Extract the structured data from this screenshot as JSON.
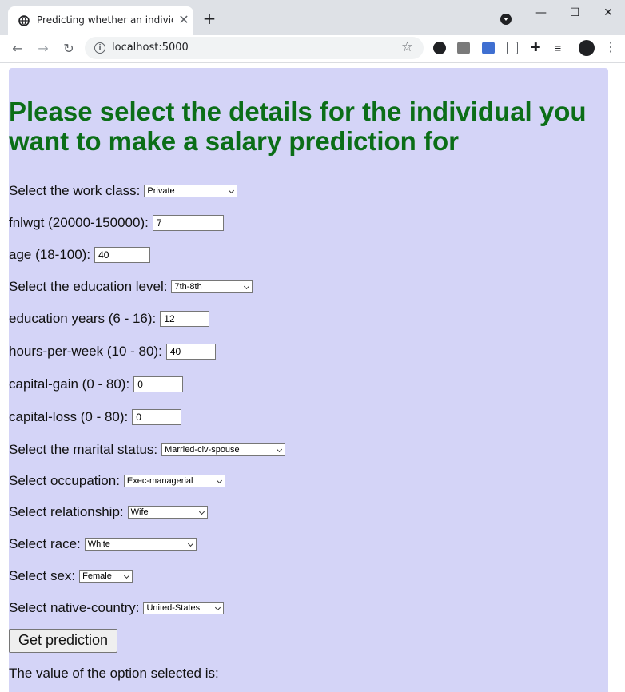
{
  "browser": {
    "tab_title": "Predicting whether an individual",
    "url": "localhost:5000"
  },
  "page": {
    "heading": "Please select the details for the individual you want to make a salary prediction for",
    "fields": {
      "workclass": {
        "label": "Select the work class:",
        "value": "Private"
      },
      "fnlwgt": {
        "label": "fnlwgt (20000-150000):",
        "value": "7"
      },
      "age": {
        "label": "age (18-100):",
        "value": "40"
      },
      "education": {
        "label": "Select the education level:",
        "value": "7th-8th"
      },
      "education_years": {
        "label": "education years (6 - 16):",
        "value": "12"
      },
      "hours_per_week": {
        "label": "hours-per-week (10 - 80):",
        "value": "40"
      },
      "capital_gain": {
        "label": "capital-gain (0 - 80):",
        "value": "0"
      },
      "capital_loss": {
        "label": "capital-loss (0 - 80):",
        "value": "0"
      },
      "marital_status": {
        "label": "Select the marital status:",
        "value": "Married-civ-spouse"
      },
      "occupation": {
        "label": "Select occupation:",
        "value": "Exec-managerial"
      },
      "relationship": {
        "label": "Select relationship:",
        "value": "Wife"
      },
      "race": {
        "label": "Select race:",
        "value": "White"
      },
      "sex": {
        "label": "Select sex:",
        "value": "Female"
      },
      "native_country": {
        "label": "Select native-country:",
        "value": "United-States"
      }
    },
    "submit_label": "Get prediction",
    "result_text": "The value of the option selected is:"
  },
  "icons": {
    "tab_close": "close-icon",
    "new_tab": "plus-icon",
    "back": "arrow-left-icon",
    "forward": "arrow-right-icon",
    "reload": "reload-icon",
    "bookmark": "star-icon"
  },
  "colors": {
    "page_background": "#d4d4f7",
    "heading": "#0b6e17"
  }
}
